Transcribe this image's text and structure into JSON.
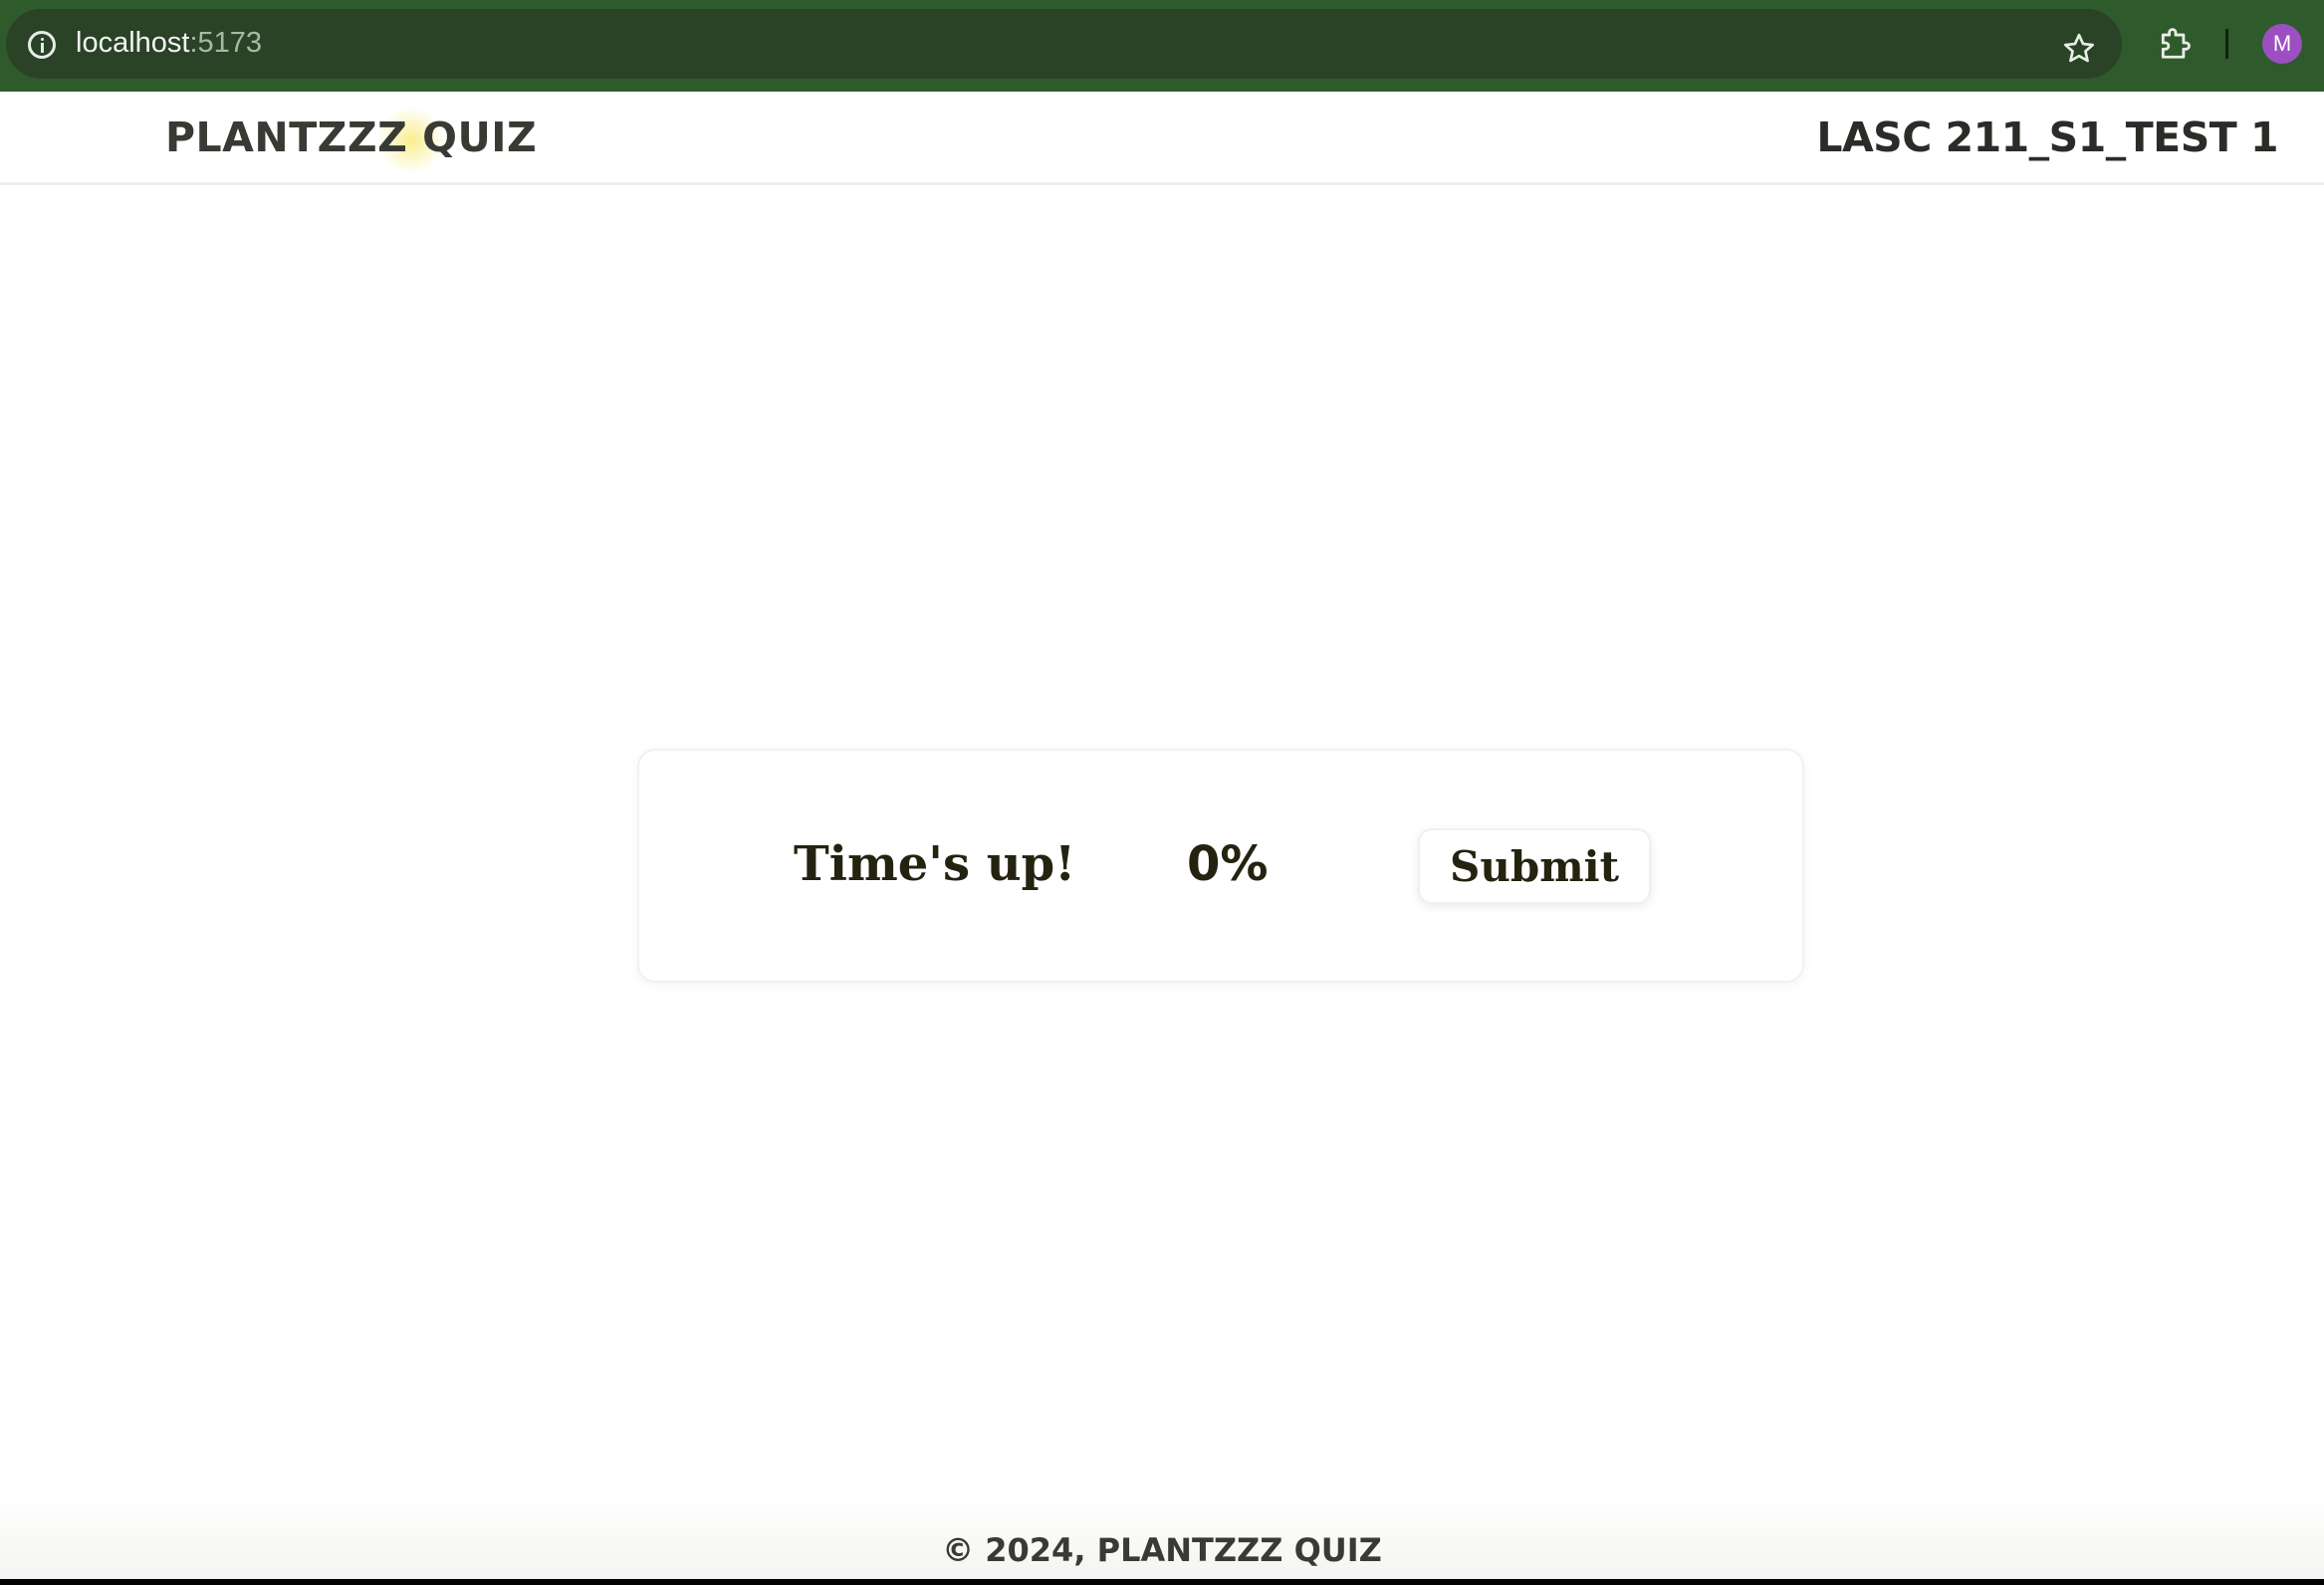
{
  "browser": {
    "url_host": "localhost",
    "url_port": ":5173",
    "profile_initial": "M",
    "icons": {
      "info": "info-icon",
      "bookmark": "star-icon",
      "extensions": "puzzle-icon"
    }
  },
  "header": {
    "brand": "PLANTZZZ QUIZ",
    "test_name": "LASC 211_S1_TEST 1"
  },
  "result": {
    "message": "Time's up!",
    "score": "0%",
    "submit_label": "Submit"
  },
  "footer": {
    "copyright": "© 2024, PLANTZZZ QUIZ"
  },
  "colors": {
    "chrome_green": "#2f5a2b",
    "omnibox": "#2a4327",
    "text_dark": "#23230f",
    "avatar": "#9b4fc1"
  }
}
